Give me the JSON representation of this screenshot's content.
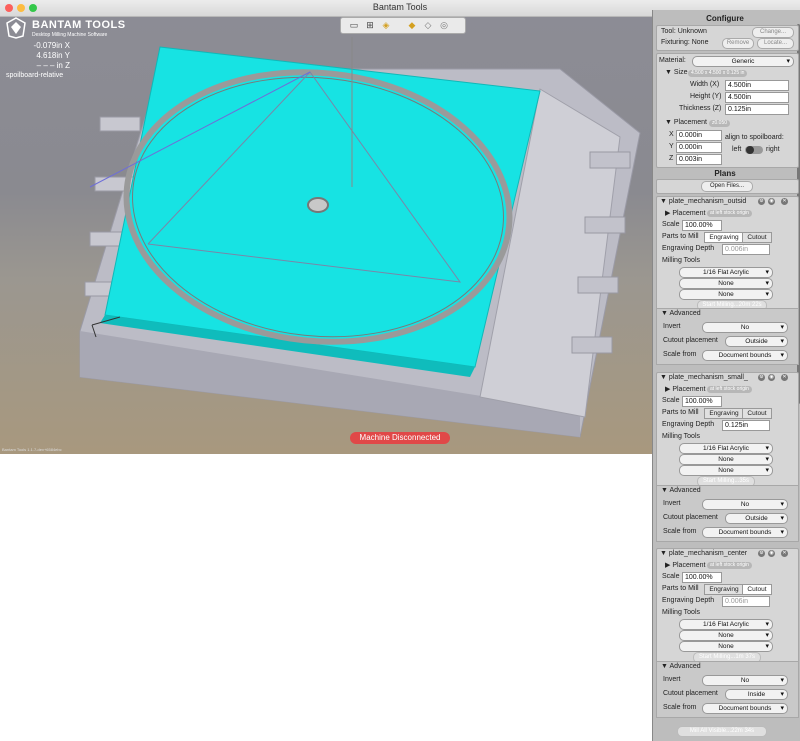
{
  "window": {
    "title": "Bantam Tools"
  },
  "colors": {
    "stock": "#17e3e3",
    "disconnected": "#e04848",
    "panel": "#bdbdbd"
  },
  "viewport": {
    "logo": "BANTAM TOOLS",
    "logo_sub": "Desktop Milling Machine Software",
    "x": "-0.079in X",
    "y": "4.618in Y",
    "z": "– – – in Z",
    "mode": "spoilboard-relative",
    "status": "Machine Disconnected",
    "version": "Bantam Tools 1.1.7-dev+6584ebc",
    "toolbar_icons": [
      "presentation-icon",
      "hierarchy-icon",
      "cube-icon",
      "pcb-icon",
      "pcb-outline-icon",
      "pcb-blank-icon"
    ]
  },
  "configure": {
    "title": "Configure",
    "tool_label": "Tool: Unknown",
    "change_btn": "Change...",
    "fixturing_label": "Fixturing: None",
    "remove_btn": "Remove",
    "locate_btn": "Locate...",
    "material_label": "Material:",
    "material_value": "Generic",
    "size_label": "Size",
    "size_badge": "4.500 x 4.500 x 0.125 in",
    "width_label": "Width (X)",
    "width_value": "4.500in",
    "height_label": "Height (Y)",
    "height_value": "4.500in",
    "thickness_label": "Thickness (Z)",
    "thickness_value": "0.125in",
    "placement_label": "Placement",
    "placement_badge": "z0.050",
    "px_label": "X",
    "px_value": "0.000in",
    "py_label": "Y",
    "py_value": "0.000in",
    "pz_label": "Z",
    "pz_value": "0.003in",
    "align_label": "align to spoilboard:",
    "left": "left",
    "right": "right"
  },
  "plans": {
    "title": "Plans",
    "open_btn": "Open Files...",
    "list": [
      {
        "name": "plate_mechanism_outsid",
        "placement": "Placement",
        "placement_badge": "at left stock origin",
        "scale_label": "Scale",
        "scale": "100.00%",
        "parts_label": "Parts to Mill",
        "engraving": "Engraving",
        "cutout": "Cutout",
        "depth_label": "Engraving Depth",
        "depth": "0.006in",
        "tools_label": "Milling Tools",
        "tools": [
          "1/16 Flat Acrylic",
          "None",
          "None"
        ],
        "start": "Start Milling...20m 22s",
        "advanced": "Advanced",
        "invert_label": "Invert",
        "invert": "No",
        "cutout_label": "Cutout placement",
        "cutout_place": "Outside",
        "scalefrom_label": "Scale from",
        "scalefrom": "Document bounds"
      },
      {
        "name": "plate_mechanism_small_",
        "placement": "Placement",
        "placement_badge": "at left stock origin",
        "scale_label": "Scale",
        "scale": "100.00%",
        "parts_label": "Parts to Mill",
        "engraving": "Engraving",
        "cutout": "Cutout",
        "depth_label": "Engraving Depth",
        "depth": "0.125in",
        "tools_label": "Milling Tools",
        "tools": [
          "1/16 Flat Acrylic",
          "None",
          "None"
        ],
        "start": "Start Milling...35s",
        "advanced": "Advanced",
        "invert_label": "Invert",
        "invert": "No",
        "cutout_label": "Cutout placement",
        "cutout_place": "Outside",
        "scalefrom_label": "Scale from",
        "scalefrom": "Document bounds"
      },
      {
        "name": "plate_mechanism_center",
        "placement": "Placement",
        "placement_badge": "at left stock origin",
        "scale_label": "Scale",
        "scale": "100.00%",
        "parts_label": "Parts to Mill",
        "engraving": "Engraving",
        "cutout": "Cutout",
        "depth_label": "Engraving Depth",
        "depth": "0.006in",
        "tools_label": "Milling Tools",
        "tools": [
          "1/16 Flat Acrylic",
          "None",
          "None"
        ],
        "start": "Start Milling...1m 37s",
        "advanced": "Advanced",
        "invert_label": "Invert",
        "invert": "No",
        "cutout_label": "Cutout placement",
        "cutout_place": "Inside",
        "scalefrom_label": "Scale from",
        "scalefrom": "Document bounds"
      }
    ],
    "mill_all": "Mill All Visible...22m 34s"
  }
}
